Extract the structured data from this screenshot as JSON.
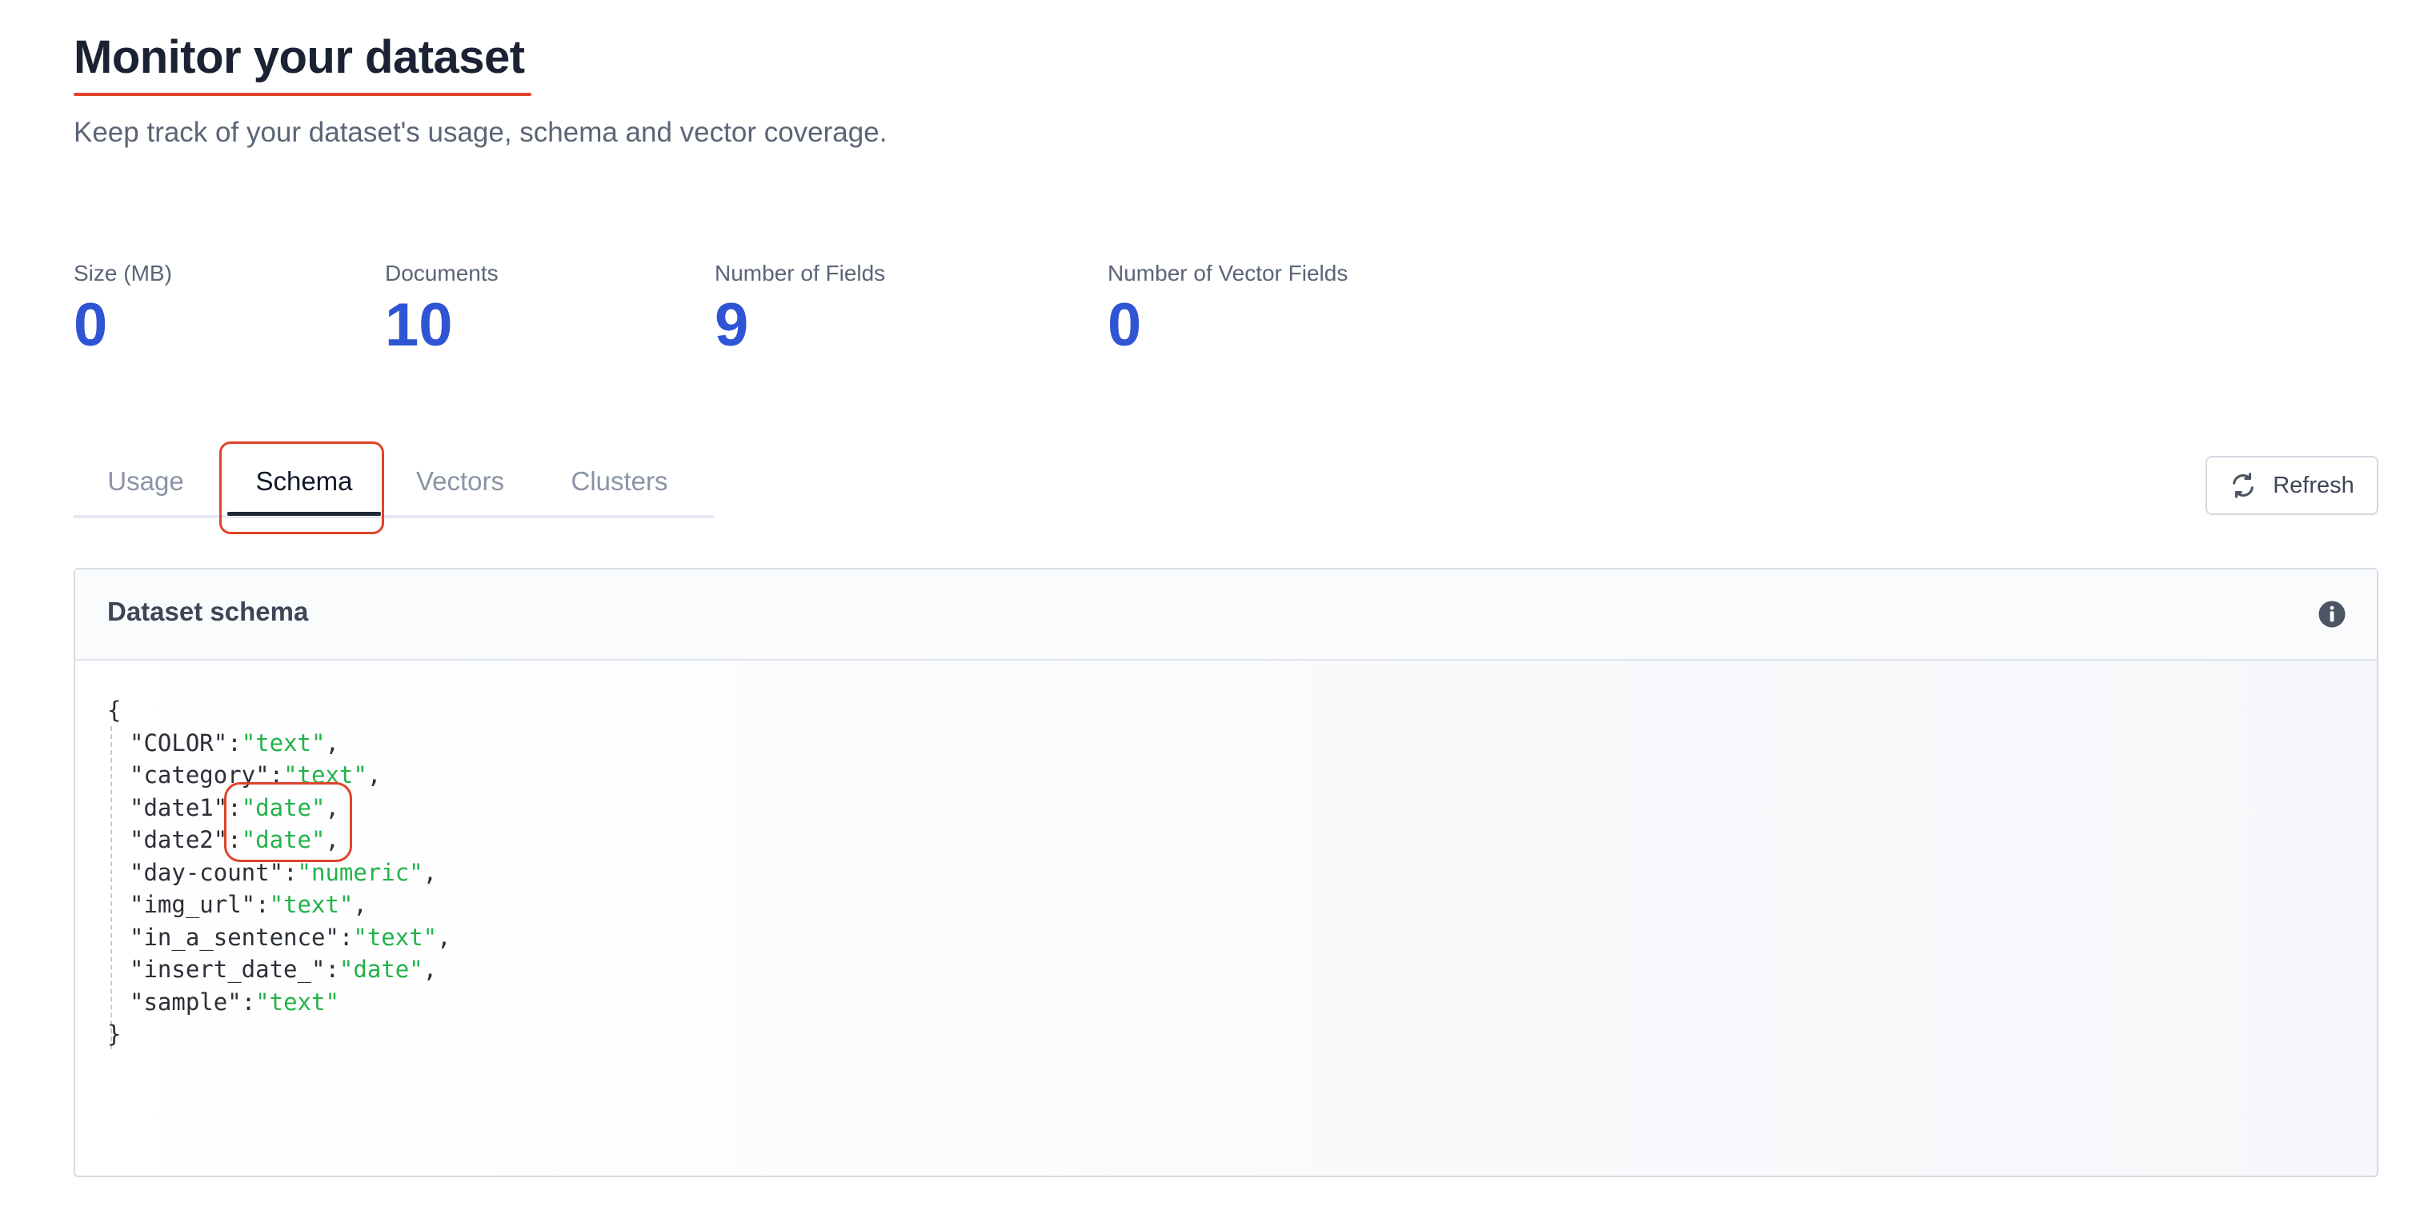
{
  "header": {
    "title": "Monitor your dataset",
    "subtitle": "Keep track of your dataset's usage, schema and vector coverage."
  },
  "stats": [
    {
      "label": "Size (MB)",
      "value": "0"
    },
    {
      "label": "Documents",
      "value": "10"
    },
    {
      "label": "Number of Fields",
      "value": "9"
    },
    {
      "label": "Number of Vector Fields",
      "value": "0"
    }
  ],
  "tabs": [
    {
      "label": "Usage"
    },
    {
      "label": "Schema"
    },
    {
      "label": "Vectors"
    },
    {
      "label": "Clusters"
    }
  ],
  "active_tab": "Schema",
  "refresh_label": "Refresh",
  "panel": {
    "title": "Dataset schema",
    "open_brace": "{",
    "close_brace": "}",
    "fields": [
      {
        "key": "\"COLOR\"",
        "value": "\"text\"",
        "sep": ","
      },
      {
        "key": "\"category\"",
        "value": "\"text\"",
        "sep": ","
      },
      {
        "key": "\"date1\"",
        "value": "\"date\"",
        "sep": ","
      },
      {
        "key": "\"date2\"",
        "value": "\"date\"",
        "sep": ","
      },
      {
        "key": "\"day-count\"",
        "value": "\"numeric\"",
        "sep": ","
      },
      {
        "key": "\"img_url\"",
        "value": "\"text\"",
        "sep": ","
      },
      {
        "key": "\"in_a_sentence\"",
        "value": "\"text\"",
        "sep": ","
      },
      {
        "key": "\"insert_date_\"",
        "value": "\"date\"",
        "sep": ","
      },
      {
        "key": "\"sample\"",
        "value": "\"text\"",
        "sep": ""
      }
    ]
  },
  "colors": {
    "accent_blue": "#2f55d4",
    "highlight_red": "#e0432b",
    "value_green": "#22b34a"
  },
  "icons": {
    "refresh": "refresh-icon",
    "info": "info-icon"
  }
}
